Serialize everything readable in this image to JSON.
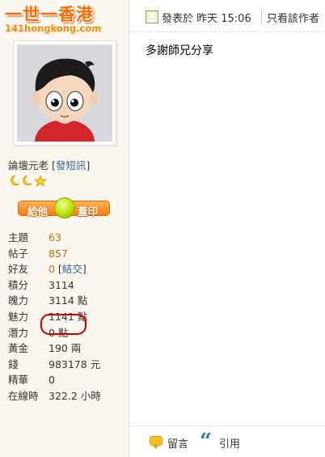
{
  "site": {
    "logo_cn": "一世一香港",
    "logo_en": "141hongkong.com"
  },
  "user": {
    "rank_label": "論壇元老",
    "send_pm": "發短訊",
    "rate_left": "給他",
    "rate_right": "蓋印",
    "stats": [
      {
        "key": "主題",
        "value": "63"
      },
      {
        "key": "帖子",
        "value": "857"
      },
      {
        "key": "好友",
        "value": "0",
        "extra": "結交"
      },
      {
        "key": "積分",
        "value": "3114"
      },
      {
        "key": "魄力",
        "value": "3114 點"
      },
      {
        "key": "魅力",
        "value": "1141 點"
      },
      {
        "key": "潛力",
        "value": "0 點"
      },
      {
        "key": "黃金",
        "value": "190 兩"
      },
      {
        "key": "錢",
        "value": "983178 元"
      },
      {
        "key": "精華",
        "value": "0"
      },
      {
        "key": "在線時",
        "value": "322.2 小時"
      }
    ]
  },
  "post": {
    "meta": "發表於 昨天 15:06",
    "only_author": "只看該作者",
    "body": "多謝師兄分享",
    "reply_label": "留言",
    "quote_label": "引用"
  },
  "colors": {
    "sidebar_bg": "#fdf8ef",
    "link": "#336699",
    "stat_link": "#b7720c",
    "accent_orange": "#ff7a10",
    "highlight_red": "#c40000"
  }
}
